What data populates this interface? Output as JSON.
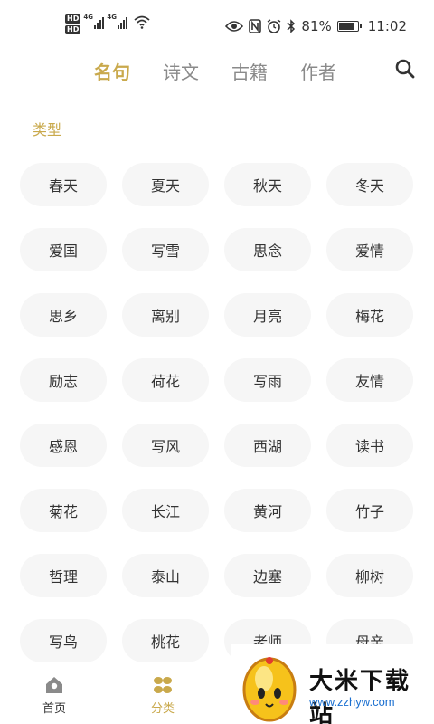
{
  "status_bar": {
    "hd1": "HD",
    "hd2": "HD",
    "net1": "4G",
    "net2": "4G",
    "battery_pct": "81%",
    "battery_level": 0.81,
    "time": "11:02",
    "icons": [
      "eye-icon",
      "nfc-icon",
      "alarm-icon",
      "bluetooth-icon",
      "battery-icon",
      "wifi-icon",
      "signal-icon"
    ]
  },
  "tabs": [
    {
      "label": "名句",
      "active": true
    },
    {
      "label": "诗文",
      "active": false
    },
    {
      "label": "古籍",
      "active": false
    },
    {
      "label": "作者",
      "active": false
    }
  ],
  "section": {
    "title": "类型"
  },
  "categories": [
    "春天",
    "夏天",
    "秋天",
    "冬天",
    "爱国",
    "写雪",
    "思念",
    "爱情",
    "思乡",
    "离别",
    "月亮",
    "梅花",
    "励志",
    "荷花",
    "写雨",
    "友情",
    "感恩",
    "写风",
    "西湖",
    "读书",
    "菊花",
    "长江",
    "黄河",
    "竹子",
    "哲理",
    "泰山",
    "边塞",
    "柳树",
    "写鸟",
    "桃花",
    "老师",
    "母亲"
  ],
  "bottom_nav": [
    {
      "label": "首页",
      "icon": "home-icon",
      "active": false
    },
    {
      "label": "分类",
      "icon": "category-icon",
      "active": true
    }
  ],
  "watermark": {
    "title": "大米下载站",
    "url": "www.zzhyw.com"
  },
  "colors": {
    "accent": "#c9a94c",
    "chip_bg": "#f6f6f6",
    "text": "#333333",
    "inactive_tab": "#8a8a8a"
  }
}
